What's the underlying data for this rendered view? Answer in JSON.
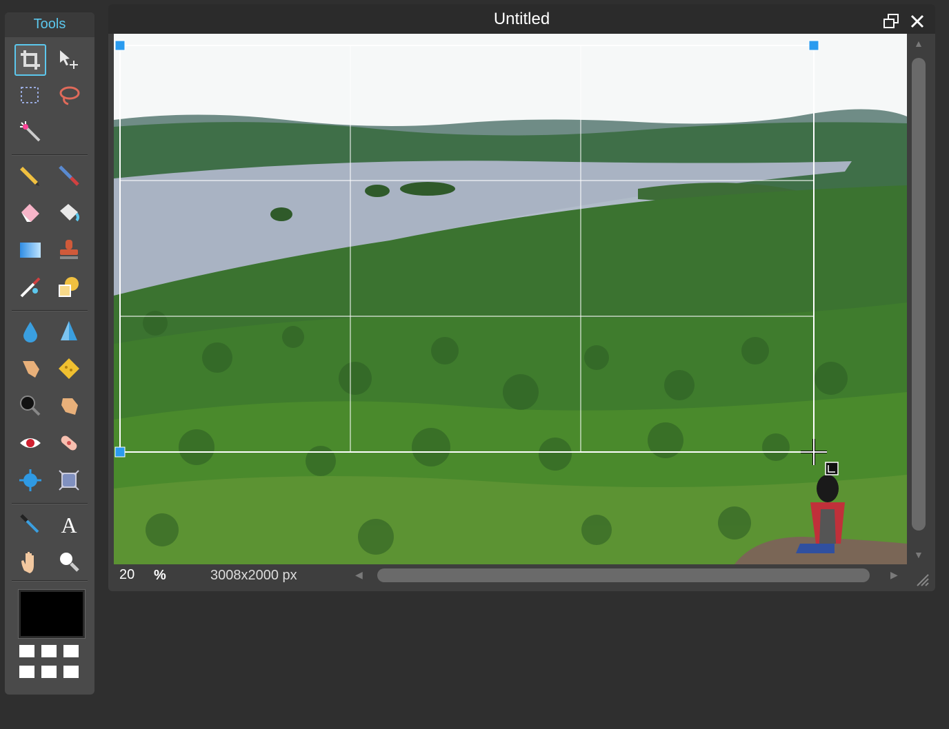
{
  "tools_panel": {
    "title": "Tools",
    "tools": [
      {
        "name": "crop-tool-icon",
        "active": true
      },
      {
        "name": "move-tool-icon"
      },
      {
        "name": "marquee-tool-icon"
      },
      {
        "name": "lasso-tool-icon"
      },
      {
        "name": "magic-wand-tool-icon"
      },
      {
        "name": "pencil-tool-icon"
      },
      {
        "name": "brush-tool-icon"
      },
      {
        "name": "eraser-tool-icon"
      },
      {
        "name": "paint-bucket-tool-icon"
      },
      {
        "name": "gradient-tool-icon"
      },
      {
        "name": "clone-stamp-tool-icon"
      },
      {
        "name": "color-replace-tool-icon"
      },
      {
        "name": "shape-tool-icon"
      },
      {
        "name": "blur-tool-icon"
      },
      {
        "name": "sharpen-tool-icon"
      },
      {
        "name": "smudge-tool-icon"
      },
      {
        "name": "sponge-tool-icon"
      },
      {
        "name": "dodge-tool-icon"
      },
      {
        "name": "burn-tool-icon"
      },
      {
        "name": "red-eye-tool-icon"
      },
      {
        "name": "spot-heal-tool-icon"
      },
      {
        "name": "bloat-tool-icon"
      },
      {
        "name": "pinch-tool-icon"
      },
      {
        "name": "color-picker-tool-icon"
      },
      {
        "name": "type-tool-icon"
      },
      {
        "name": "hand-tool-icon"
      },
      {
        "name": "zoom-tool-icon"
      }
    ],
    "foreground_color": "#000000"
  },
  "image_window": {
    "title": "Untitled",
    "zoom_value": "20",
    "zoom_unit": "%",
    "dimensions": "3008x2000 px"
  }
}
